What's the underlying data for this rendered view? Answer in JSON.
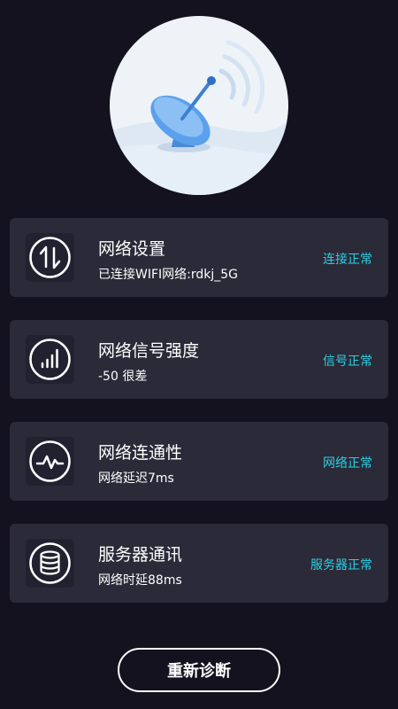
{
  "hero": {
    "icon": "satellite-dish-icon"
  },
  "cards": [
    {
      "icon": "up-down-arrows-icon",
      "title": "网络设置",
      "detail": "已连接WIFI网络:rdkj_5G",
      "status": "连接正常"
    },
    {
      "icon": "signal-bars-icon",
      "title": "网络信号强度",
      "detail": "-50 很差",
      "status": "信号正常"
    },
    {
      "icon": "pulse-wave-icon",
      "title": "网络连通性",
      "detail": "网络延迟7ms",
      "status": "网络正常"
    },
    {
      "icon": "database-icon",
      "title": "服务器通讯",
      "detail": "网络时延88ms",
      "status": "服务器正常"
    }
  ],
  "button": {
    "label": "重新诊断"
  },
  "colors": {
    "background": "#14121f",
    "card": "#2b2a38",
    "accent": "#2bd0e6"
  }
}
